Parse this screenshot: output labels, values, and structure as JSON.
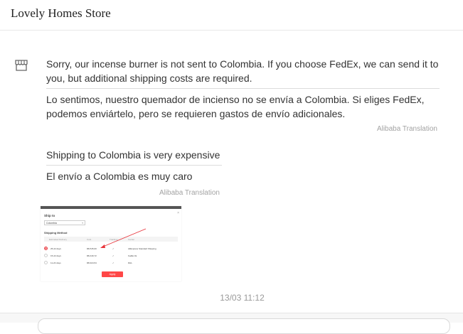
{
  "store": {
    "name": "Lovely Homes Store"
  },
  "messages": [
    {
      "original": "Sorry, our incense burner is not sent to Colombia. If you choose FedEx, we can send it to you, but additional shipping costs are required.",
      "translated": "Lo sentimos, nuestro quemador de incienso no se envía a Colombia. Si eliges FedEx, podemos enviártelo, pero se requieren gastos de envío adicionales.",
      "translation_label": "Alibaba Translation"
    },
    {
      "original": "Shipping to Colombia is very expensive",
      "translated": "El envío a Colombia es muy caro",
      "translation_label": "Alibaba Translation"
    }
  ],
  "attachment": {
    "title": "Ship to",
    "country": "Colombia",
    "method_title": "Shipping Method",
    "columns": [
      "Estimated Delivery",
      "Cost",
      "Tracking",
      "Carrier"
    ],
    "rows": [
      {
        "delivery": "25-22 days",
        "cost": "R$ 545,60",
        "tracking": "✓",
        "carrier": "AliExpress Standard Shipping",
        "selected": true
      },
      {
        "delivery": "15-22 days",
        "cost": "R$ 449,72",
        "tracking": "✓",
        "carrier": "FedEx IE",
        "selected": false
      },
      {
        "delivery": "11-24 days",
        "cost": "R$ 924,54",
        "tracking": "✓",
        "carrier": "DHL",
        "selected": false
      }
    ],
    "apply_label": "Apply"
  },
  "timestamp": "13/03 11:12",
  "colors": {
    "accent": "#ff4747",
    "text": "#333333",
    "muted": "#999999"
  }
}
